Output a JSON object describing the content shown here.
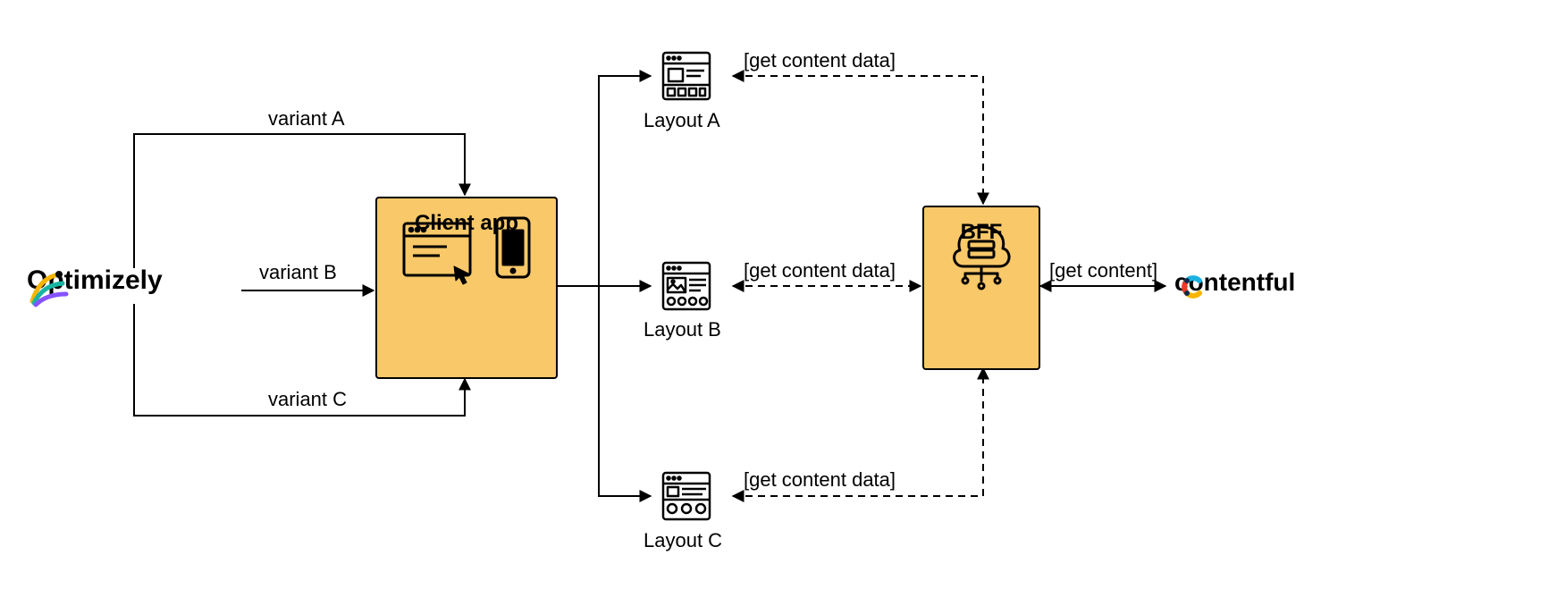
{
  "logos": {
    "optimizely": "Optimizely",
    "contentful": "contentful"
  },
  "nodes": {
    "client_app": "Client app",
    "bff": "BFF",
    "layout_a": "Layout A",
    "layout_b": "Layout B",
    "layout_c": "Layout C"
  },
  "edges": {
    "variant_a": "variant A",
    "variant_b": "variant B",
    "variant_c": "variant C",
    "get_content_data_a": "[get content data]",
    "get_content_data_b": "[get content data]",
    "get_content_data_c": "[get content data]",
    "get_content": "[get content]"
  }
}
